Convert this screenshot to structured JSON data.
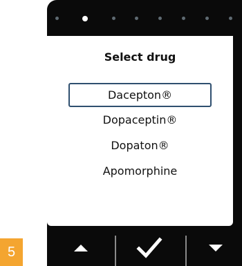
{
  "pager": {
    "page_count": 8,
    "active_index": 1
  },
  "dialog": {
    "title": "Select drug",
    "items": [
      {
        "label": "Dacepton®",
        "selected": true
      },
      {
        "label": "Dopaceptin®",
        "selected": false
      },
      {
        "label": "Dopaton®",
        "selected": false
      },
      {
        "label": "Apomorphine",
        "selected": false
      }
    ]
  },
  "softkeys": {
    "left_icon": "triangle-up-icon",
    "center_icon": "checkmark-icon",
    "right_icon": "triangle-down-icon"
  },
  "step_badge": {
    "number": "5"
  },
  "colors": {
    "screen_background": "#0a0a0a",
    "selection_border": "#2f4f6f",
    "badge_orange": "#f4a530"
  }
}
